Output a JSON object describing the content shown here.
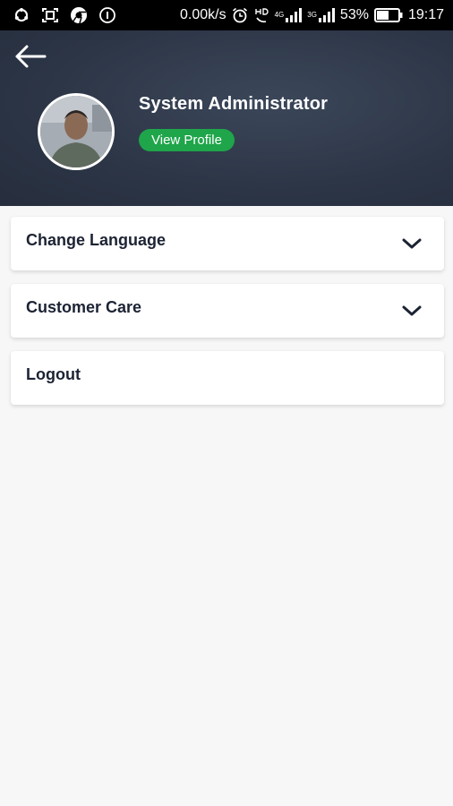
{
  "status_bar": {
    "network_speed": "0.00k/s",
    "network_type_1": "4G",
    "network_type_2": "3G",
    "battery": "53%",
    "time": "19:17",
    "icons": [
      "sync-icon",
      "screenshot-icon",
      "chrome-icon",
      "notification-one-icon",
      "alarm-icon",
      "hd-voice-icon",
      "signal-icon",
      "signal-icon",
      "battery-icon"
    ]
  },
  "header": {
    "back_icon": "arrow-left-icon",
    "name": "System Administrator",
    "view_profile_label": "View Profile",
    "background_color": "#2f3848",
    "badge_color": "#1fa54a"
  },
  "menu": {
    "items": [
      {
        "label": "Change Language",
        "icon": "chevron-down-icon"
      },
      {
        "label": "Customer Care",
        "icon": "chevron-down-icon"
      },
      {
        "label": "Logout"
      }
    ]
  }
}
